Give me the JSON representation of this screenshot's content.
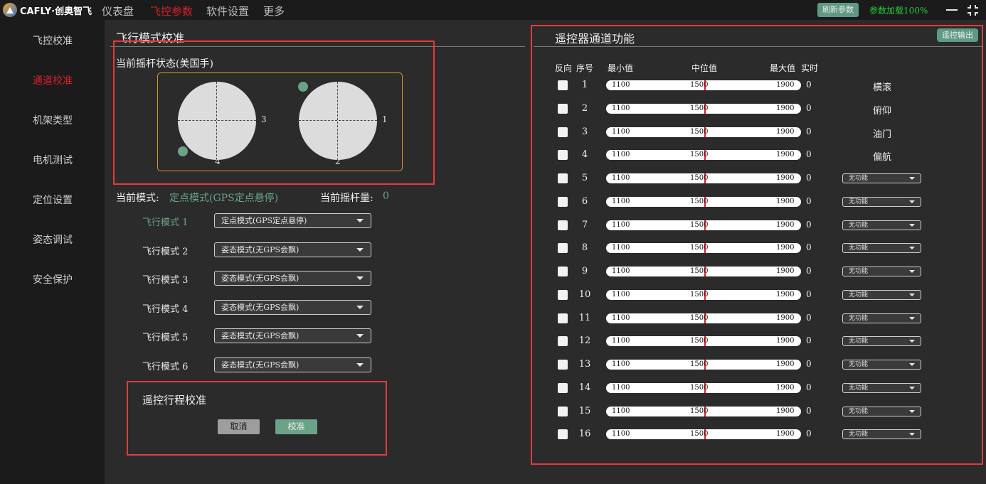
{
  "topbar": {
    "logo_text": "CAFLY·创奥智飞",
    "nav": [
      "仪表盘",
      "飞控参数",
      "软件设置",
      "更多"
    ],
    "active_nav": "飞控参数",
    "refresh_button": "刷新参数",
    "load_status": "参数加载100%",
    "accent_color": "#d8202a",
    "status_color": "#28c840"
  },
  "sidebar": {
    "items": [
      "飞控校准",
      "通道校准",
      "机架类型",
      "电机测试",
      "定位设置",
      "姿态调试",
      "安全保护"
    ],
    "active": "通道校准"
  },
  "flight_mode": {
    "title": "飞行模式校准",
    "stick_title": "当前摇杆状态(美国手)",
    "stick_labels": [
      "3",
      "4",
      "1",
      "2"
    ],
    "current_mode_label": "当前模式:",
    "current_mode_value": "定点模式(GPS定点悬停)",
    "stick_amount_label": "当前摇杆量:",
    "stick_amount_value": "0",
    "modes": [
      {
        "label": "飞行模式 1",
        "value": "定点模式(GPS定点悬停)"
      },
      {
        "label": "飞行模式 2",
        "value": "姿态模式(无GPS会飘)"
      },
      {
        "label": "飞行模式 3",
        "value": "姿态模式(无GPS会飘)"
      },
      {
        "label": "飞行模式 4",
        "value": "姿态模式(无GPS会飘)"
      },
      {
        "label": "飞行模式 5",
        "value": "姿态模式(无GPS会飘)"
      },
      {
        "label": "飞行模式 6",
        "value": "姿态模式(无GPS会飘)"
      }
    ]
  },
  "rc_travel": {
    "title": "遥控行程校准",
    "cancel": "取消",
    "calibrate": "校准"
  },
  "channels": {
    "title": "遥控器通道功能",
    "output_button": "遥控输出",
    "headers": {
      "reverse": "反向",
      "index": "序号",
      "min": "最小值",
      "mid": "中位值",
      "max": "最大值",
      "realtime": "实时"
    },
    "rows": [
      {
        "idx": "1",
        "min": "1100",
        "mid": "1500",
        "max": "1900",
        "rt": "0",
        "fn": "横滚"
      },
      {
        "idx": "2",
        "min": "1100",
        "mid": "1500",
        "max": "1900",
        "rt": "0",
        "fn": "俯仰"
      },
      {
        "idx": "3",
        "min": "1100",
        "mid": "1500",
        "max": "1900",
        "rt": "0",
        "fn": "油门"
      },
      {
        "idx": "4",
        "min": "1100",
        "mid": "1500",
        "max": "1900",
        "rt": "0",
        "fn": "偏航"
      },
      {
        "idx": "5",
        "min": "1100",
        "mid": "1500",
        "max": "1900",
        "rt": "0",
        "sel": "无功能"
      },
      {
        "idx": "6",
        "min": "1100",
        "mid": "1500",
        "max": "1900",
        "rt": "0",
        "sel": "无功能"
      },
      {
        "idx": "7",
        "min": "1100",
        "mid": "1500",
        "max": "1900",
        "rt": "0",
        "sel": "无功能"
      },
      {
        "idx": "8",
        "min": "1100",
        "mid": "1500",
        "max": "1900",
        "rt": "0",
        "sel": "无功能"
      },
      {
        "idx": "9",
        "min": "1100",
        "mid": "1500",
        "max": "1900",
        "rt": "0",
        "sel": "无功能"
      },
      {
        "idx": "10",
        "min": "1100",
        "mid": "1500",
        "max": "1900",
        "rt": "0",
        "sel": "无功能"
      },
      {
        "idx": "11",
        "min": "1100",
        "mid": "1500",
        "max": "1900",
        "rt": "0",
        "sel": "无功能"
      },
      {
        "idx": "12",
        "min": "1100",
        "mid": "1500",
        "max": "1900",
        "rt": "0",
        "sel": "无功能"
      },
      {
        "idx": "13",
        "min": "1100",
        "mid": "1500",
        "max": "1900",
        "rt": "0",
        "sel": "无功能"
      },
      {
        "idx": "14",
        "min": "1100",
        "mid": "1500",
        "max": "1900",
        "rt": "0",
        "sel": "无功能"
      },
      {
        "idx": "15",
        "min": "1100",
        "mid": "1500",
        "max": "1900",
        "rt": "0",
        "sel": "无功能"
      },
      {
        "idx": "16",
        "min": "1100",
        "mid": "1500",
        "max": "1900",
        "rt": "0",
        "sel": "无功能"
      }
    ]
  }
}
